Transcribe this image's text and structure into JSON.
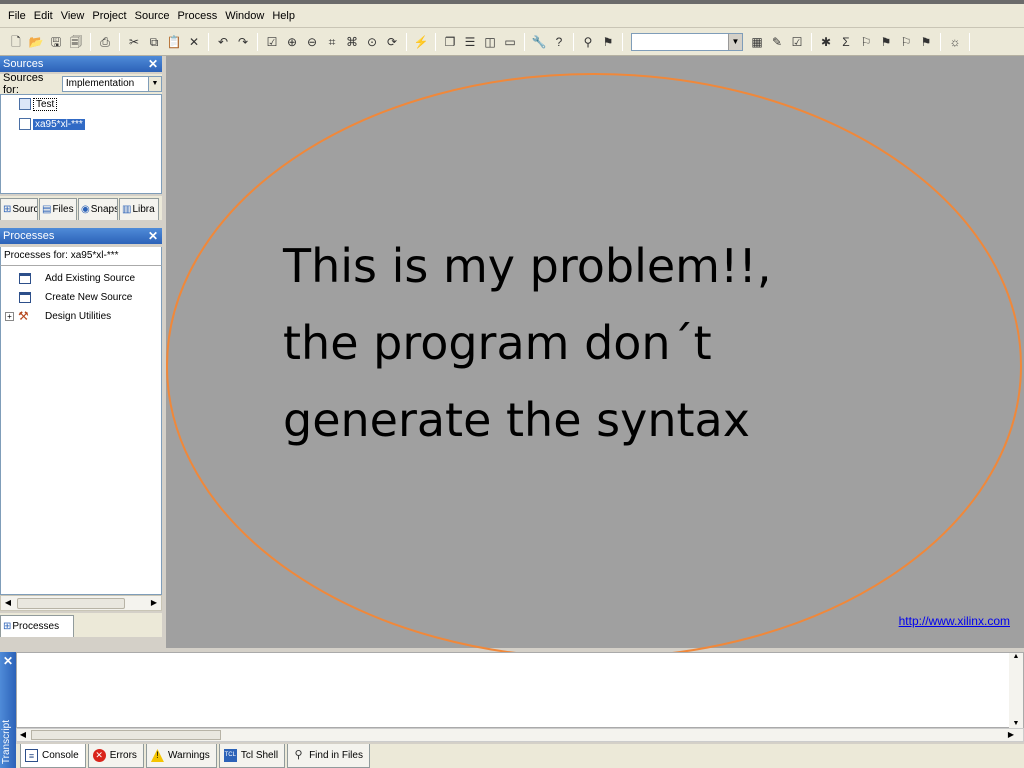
{
  "menu": [
    "File",
    "Edit",
    "View",
    "Project",
    "Source",
    "Process",
    "Window",
    "Help"
  ],
  "toolbar": {
    "groups": [
      [
        "new-file-icon",
        "open-file-icon",
        "save-icon",
        "save-all-icon"
      ],
      [
        "print-icon"
      ],
      [
        "cut-icon",
        "copy-icon",
        "paste-icon",
        "delete-icon"
      ],
      [
        "undo-icon",
        "redo-icon"
      ],
      [
        "check-icon",
        "zoom-in-icon",
        "zoom-out-icon",
        "zoom-fit-icon",
        "zoom-full-icon",
        "zoom-area-icon",
        "refresh-icon"
      ],
      [
        "wizard-icon"
      ],
      [
        "cascade-icon",
        "tile-horizontal-icon",
        "tile-vertical-icon",
        "window-icon"
      ],
      [
        "tools-icon",
        "help-pointer-icon"
      ],
      [
        "find-icon",
        "find-in-files-icon"
      ]
    ],
    "search_value": "",
    "groups_right": [
      [
        "report-icon",
        "edit-icon",
        "check-box-icon"
      ],
      [
        "bug-icon",
        "sigma-icon",
        "bookmark-icon",
        "bookmark-next-icon",
        "bookmark-prev-icon",
        "bookmark-clear-icon"
      ],
      [
        "lightbulb-icon"
      ]
    ]
  },
  "sources": {
    "title": "Sources",
    "for_label": "Sources for:",
    "for_value": "Implementation",
    "tree": [
      {
        "label": "Test",
        "selected": false
      },
      {
        "label": "xa95*xl-***",
        "selected": true
      }
    ],
    "tabs": [
      {
        "label": "Sourc",
        "icon": "sources-tab-icon"
      },
      {
        "label": "Files",
        "icon": "files-tab-icon"
      },
      {
        "label": "Snaps",
        "icon": "snapshots-tab-icon"
      },
      {
        "label": "Libra",
        "icon": "libraries-tab-icon"
      }
    ]
  },
  "processes": {
    "title": "Processes",
    "for_label": "Processes for: xa95*xl-***",
    "items": [
      {
        "label": "Add Existing Source",
        "icon": "add-source-icon"
      },
      {
        "label": "Create New Source",
        "icon": "create-source-icon"
      },
      {
        "label": "Design Utilities",
        "icon": "design-utilities-icon"
      }
    ],
    "tab_label": "Processes"
  },
  "workspace": {
    "message": "This is my problem!!,\nthe program don´t\ngenerate the syntax",
    "ellipse_color": "#f0883a",
    "link": "http://www.xilinx.com"
  },
  "transcript": {
    "label": "Transcript",
    "tabs": [
      {
        "label": "Console",
        "icon": "console-icon",
        "active": true
      },
      {
        "label": "Errors",
        "icon": "errors-icon",
        "active": false
      },
      {
        "label": "Warnings",
        "icon": "warnings-icon",
        "active": false
      },
      {
        "label": "Tcl Shell",
        "icon": "tcl-shell-icon",
        "active": false
      },
      {
        "label": "Find in Files",
        "icon": "find-in-files-icon",
        "active": false
      }
    ]
  }
}
